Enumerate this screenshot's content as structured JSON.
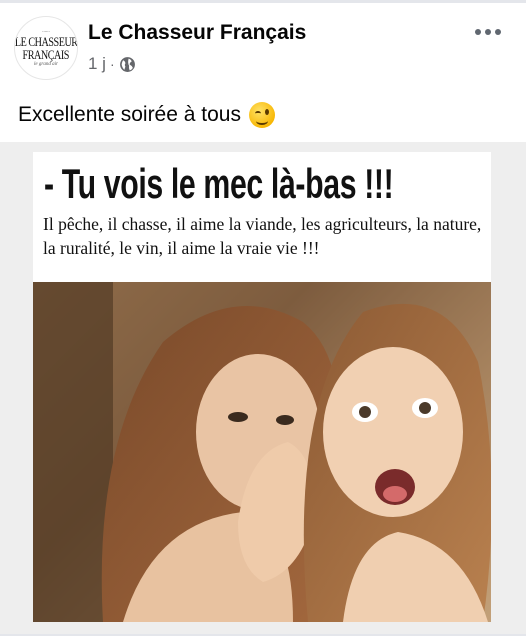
{
  "post": {
    "page_name": "Le Chasseur Français",
    "time_ago": "1 j",
    "separator": "·",
    "privacy_icon": "globe-icon",
    "more_icon": "more-options-icon",
    "caption": "Excellente soirée à tous",
    "caption_emoji": "winking-face-icon"
  },
  "logo": {
    "small_text": "......",
    "line1": "LE CHASSEUR",
    "line2": "FRANÇAIS",
    "tagline": "le grand air"
  },
  "meme": {
    "title": "- Tu vois le mec là-bas !!!",
    "body": "Il pêche, il chasse, il aime la viande, les agriculteurs, la nature, la ruralité, le vin, il aime la vraie vie !!!",
    "photo": "photo-two-women-whispering"
  },
  "colors": {
    "text_primary": "#050505",
    "text_secondary": "#65676b",
    "divider": "#e4e6eb"
  }
}
